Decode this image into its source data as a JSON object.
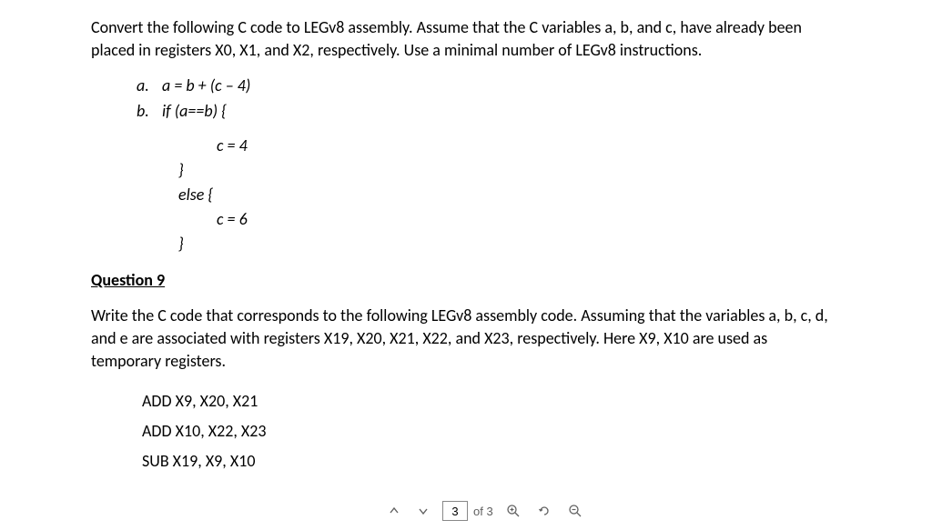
{
  "question8": {
    "intro": "Convert the following C code to LEGv8 assembly. Assume that the C variables a, b, and c, have already been placed in registers X0, X1, and X2, respectively. Use a minimal number of LEGv8 instructions.",
    "partA": {
      "label": "a.",
      "code": "a = b + (c – 4)"
    },
    "partB": {
      "label": "b.",
      "line1": "if (a==b) {",
      "line2": "c = 4",
      "line3": "}",
      "line4": "else {",
      "line5": "c = 6",
      "line6": "}"
    }
  },
  "question9": {
    "heading": "Question 9",
    "intro": "Write the C code that corresponds to the following LEGv8 assembly code. Assuming that the variables a, b, c, d, and e are associated with registers X19, X20, X21, X22, and X23, respectively. Here X9, X10 are used as temporary registers.",
    "asm": {
      "line1": "ADD X9, X20, X21",
      "line2": "ADD X10, X22, X23",
      "line3": "SUB X19, X9, X10"
    }
  },
  "toolbar": {
    "currentPage": "3",
    "totalPages": "of 3"
  }
}
